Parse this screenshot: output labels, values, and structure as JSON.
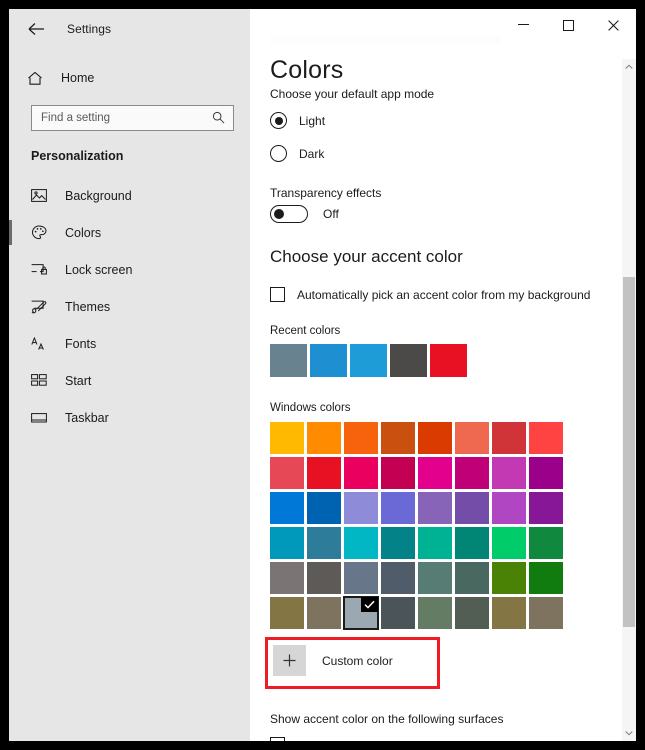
{
  "window": {
    "title": "Settings",
    "back_icon": "back-arrow-icon",
    "minimize": "─",
    "maximize": "☐",
    "close": "✕"
  },
  "sidebar": {
    "home_label": "Home",
    "home_icon": "home-icon",
    "search": {
      "placeholder": "Find a setting",
      "value": "",
      "icon": "search-icon"
    },
    "category": "Personalization",
    "items": [
      {
        "label": "Background",
        "icon": "image-icon",
        "selected": false
      },
      {
        "label": "Colors",
        "icon": "palette-icon",
        "selected": true
      },
      {
        "label": "Lock screen",
        "icon": "lock-screen-icon",
        "selected": false
      },
      {
        "label": "Themes",
        "icon": "themes-icon",
        "selected": false
      },
      {
        "label": "Fonts",
        "icon": "fonts-icon",
        "selected": false
      },
      {
        "label": "Start",
        "icon": "start-icon",
        "selected": false
      },
      {
        "label": "Taskbar",
        "icon": "taskbar-icon",
        "selected": false
      }
    ]
  },
  "main": {
    "page_title": "Colors",
    "app_mode": {
      "label": "Choose your default app mode",
      "options": [
        {
          "label": "Light",
          "selected": true
        },
        {
          "label": "Dark",
          "selected": false
        }
      ]
    },
    "transparency": {
      "label": "Transparency effects",
      "state": "Off",
      "on": false
    },
    "accent": {
      "heading": "Choose your accent color",
      "auto_pick": {
        "label": "Automatically pick an accent color from my background",
        "checked": false
      },
      "recent_label": "Recent colors",
      "recent_colors": [
        "#69828f",
        "#1e90d2",
        "#1e9cd7",
        "#4c4a48",
        "#e81123"
      ],
      "windows_label": "Windows colors",
      "windows_colors": [
        [
          "#ffb900",
          "#ff8c00",
          "#f7630c",
          "#ca5010",
          "#da3b01",
          "#ef6950",
          "#d13438",
          "#ff4343"
        ],
        [
          "#e74856",
          "#e81123",
          "#ea005e",
          "#c30052",
          "#e3008c",
          "#bf0077",
          "#c239b3",
          "#9a0089"
        ],
        [
          "#0078d7",
          "#0063b1",
          "#8e8cd8",
          "#6b69d6",
          "#8764b8",
          "#744da9",
          "#b146c2",
          "#881798"
        ],
        [
          "#0099bc",
          "#2d7d9a",
          "#00b7c3",
          "#038387",
          "#00b294",
          "#018574",
          "#00cc6a",
          "#10893e"
        ],
        [
          "#7a7574",
          "#5d5a58",
          "#68768a",
          "#515c6b",
          "#567c73",
          "#486860",
          "#498205",
          "#107c10"
        ],
        [
          "#847545",
          "#7e735f",
          "#9ba8b2",
          "#4a5459",
          "#647c64",
          "#525e54",
          "#847545",
          "#7e735f"
        ]
      ],
      "selected": {
        "row": 5,
        "col": 2,
        "check_icon": "checkmark-icon"
      },
      "custom": {
        "label": "Custom color",
        "plus_icon": "plus-icon",
        "highlight_color": "#ee1c24"
      }
    },
    "surfaces": {
      "label": "Show accent color on the following surfaces"
    }
  }
}
